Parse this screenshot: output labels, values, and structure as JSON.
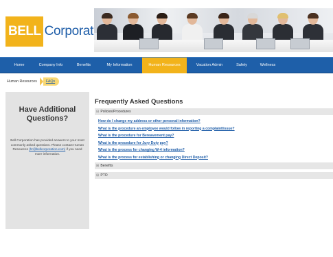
{
  "brand": {
    "logo_box": "BELL",
    "logo_text": "Corporation"
  },
  "nav": {
    "items": [
      {
        "label": "Home"
      },
      {
        "label": "Company Info"
      },
      {
        "label": "Benefits"
      },
      {
        "label": "My Information"
      },
      {
        "label": "Human Resources"
      },
      {
        "label": "Vacation Admin"
      },
      {
        "label": "Safety"
      },
      {
        "label": "Wellness"
      }
    ],
    "active_label": "Human Resources"
  },
  "breadcrumb": {
    "parent": "Human Resources",
    "current": "FAQs"
  },
  "sidebar": {
    "title": "Have Additional Questions?",
    "text_before": "Bell Corporation has provided answers to your most commonly asked questions. Please contact Human Resources",
    "email": "(hr@bellcorporation.com)",
    "text_after": "if you need more information."
  },
  "main": {
    "title": "Frequently Asked Questions",
    "sections": [
      {
        "label": "Policies/Procedures",
        "expanded": true,
        "questions": [
          "How do I change my address or other personal information?",
          "What is the procedure an employee would follow in reporting a complaint/issue?",
          "What is the procedure for Bereavement pay?",
          "What is the procedure for Jury Duty pay?",
          "What is the process for changing W-4 information?",
          "What is the process for establishing or changing Direct Deposit?"
        ]
      },
      {
        "label": "Benefits",
        "expanded": false
      },
      {
        "label": "PTO",
        "expanded": false
      }
    ]
  },
  "colors": {
    "brand_blue": "#1e5fa9",
    "accent_gold": "#f2b31b",
    "sidebar_gray": "#e3e3e3"
  }
}
